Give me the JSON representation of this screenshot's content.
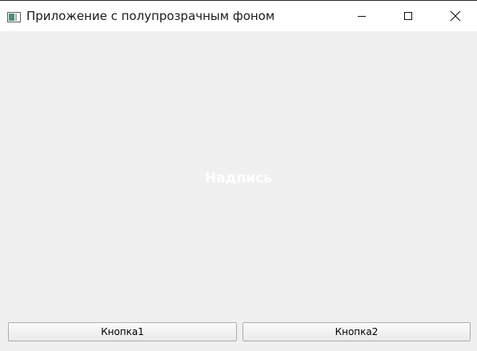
{
  "window": {
    "title": "Приложение с полупрозрачным фоном"
  },
  "content": {
    "label_text": "Надпись",
    "button1_label": "Кнопка1",
    "button2_label": "Кнопка2"
  },
  "icons": {
    "app": "app-window-icon",
    "minimize": "minimize-icon",
    "maximize": "maximize-icon",
    "close": "close-icon"
  },
  "colors": {
    "background": "#f0f0f0",
    "titlebar": "#ffffff",
    "label": "#ffffff"
  }
}
